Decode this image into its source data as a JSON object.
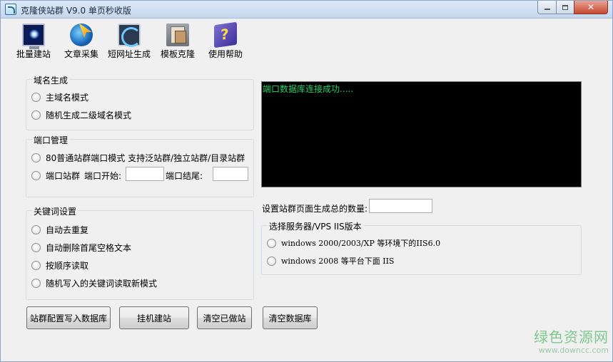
{
  "window": {
    "title": "克隆侠站群 V9.0 单页秒收版",
    "close_glyph": "✕"
  },
  "toolbar": [
    {
      "id": "batch",
      "label": "批量建站",
      "icon": "monitor-icon"
    },
    {
      "id": "article",
      "label": "文章采集",
      "icon": "globe-cursor-icon"
    },
    {
      "id": "short",
      "label": "短网址生成",
      "icon": "network-link-icon"
    },
    {
      "id": "template",
      "label": "模板克隆",
      "icon": "documents-icon"
    },
    {
      "id": "help",
      "label": "使用帮助",
      "icon": "help-book-icon"
    }
  ],
  "domain_group": {
    "title": "域名生成",
    "options": [
      "主域名模式",
      "随机生成二级域名模式"
    ]
  },
  "port_group": {
    "title": "端口管理",
    "option1": "80普通站群端口模式 支持泛站群/独立站群/目录站群",
    "option2": "端口站群",
    "start_label": "端口开始:",
    "start_value": "",
    "end_label": "端口结尾:",
    "end_value": ""
  },
  "keyword_group": {
    "title": "关键词设置",
    "options": [
      "自动去重复",
      "自动删除首尾空格文本",
      "按顺序读取",
      "随机写入的关键词读取新模式"
    ]
  },
  "console": {
    "text": "端口数据库连接成功....."
  },
  "page_count": {
    "label": "设置站群页面生成总的数量:",
    "value": ""
  },
  "iis_group": {
    "title": "选择服务器/VPS IIS版本",
    "options": [
      "windows 2000/2003/XP 等环境下的IIS6.0",
      "windows 2008 等平台下面 IIS"
    ]
  },
  "buttons": {
    "write_db": "站群配置写入数据库",
    "hang": "挂机建站",
    "clear_done": "清空已做站",
    "clear_db": "清空数据库"
  },
  "watermark": {
    "name": "绿色资源网",
    "url": "www.downcc.com"
  },
  "colors": {
    "console_bg": "#000000",
    "console_text": "#22d36a",
    "window_bg": "#f0f0f0",
    "watermark": "#7ec88e"
  }
}
